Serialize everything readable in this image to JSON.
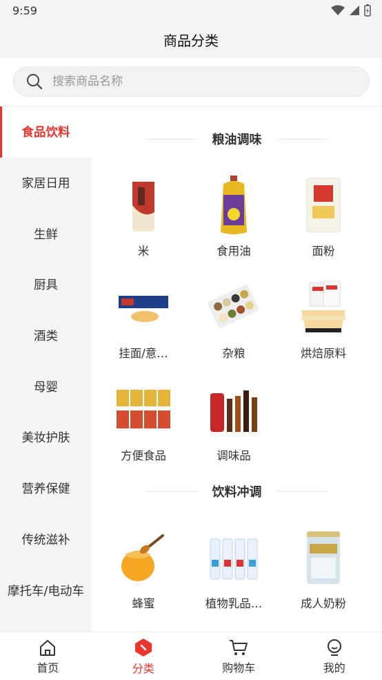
{
  "status_bar": {
    "time": "9:59"
  },
  "header": {
    "title": "商品分类"
  },
  "search": {
    "placeholder": "搜索商品名称"
  },
  "sidebar": {
    "items": [
      {
        "label": "食品饮料",
        "active": true
      },
      {
        "label": "家居日用"
      },
      {
        "label": "生鲜"
      },
      {
        "label": "厨具"
      },
      {
        "label": "酒类"
      },
      {
        "label": "母婴"
      },
      {
        "label": "美妆护肤"
      },
      {
        "label": "营养保健"
      },
      {
        "label": "传统滋补"
      },
      {
        "label": "摩托车/电动车"
      }
    ]
  },
  "sections": [
    {
      "title": "粮油调味",
      "items": [
        {
          "name": "米",
          "icon": "rice-bag"
        },
        {
          "name": "食用油",
          "icon": "oil-bottle"
        },
        {
          "name": "面粉",
          "icon": "flour-bag"
        },
        {
          "name": "挂面/意…",
          "icon": "pasta-box"
        },
        {
          "name": "杂粮",
          "icon": "grain-tray"
        },
        {
          "name": "烘焙原料",
          "icon": "cake"
        },
        {
          "name": "方便食品",
          "icon": "instant-noodle-cups"
        },
        {
          "name": "调味品",
          "icon": "sauce-bottles"
        }
      ]
    },
    {
      "title": "饮料冲调",
      "items": [
        {
          "name": "蜂蜜",
          "icon": "honey-jar"
        },
        {
          "name": "植物乳品…",
          "icon": "milk-bottles"
        },
        {
          "name": "成人奶粉",
          "icon": "milk-powder-can"
        }
      ]
    }
  ],
  "tabbar": {
    "tabs": [
      {
        "label": "首页",
        "icon": "home-icon"
      },
      {
        "label": "分类",
        "icon": "category-icon",
        "active": true
      },
      {
        "label": "购物车",
        "icon": "cart-icon"
      },
      {
        "label": "我的",
        "icon": "profile-icon"
      }
    ]
  },
  "colors": {
    "accent": "#e8362f",
    "sidebar_bg": "#f5f5f5",
    "bar_bg": "#f4f4f4"
  }
}
